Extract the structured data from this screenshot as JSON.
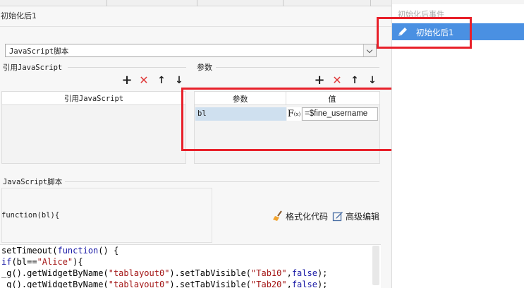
{
  "panel": {
    "title": "初始化后1"
  },
  "script_type": {
    "value": "JavaScript脚本"
  },
  "references": {
    "label": "引用JavaScript",
    "column_header": "引用JavaScript"
  },
  "params": {
    "label": "参数",
    "columns": [
      "参数",
      "值"
    ],
    "rows": [
      {
        "name": "bl",
        "formula_icon": "F",
        "formula_sub": "(x)",
        "value": "=$fine_username"
      }
    ]
  },
  "script": {
    "label": "JavaScript脚本",
    "signature": "function(bl){",
    "format_label": "格式化代码",
    "advanced_label": "高级编辑",
    "code_lines": [
      "setTimeout(function() {",
      "if(bl==\"Alice\"){",
      "_g().getWidgetByName(\"tablayout0\").setTabVisible(\"Tab10\",false);",
      "_g().getWidgetByName(\"tablayout0\").setTabVisible(\"Tab20\",false);"
    ]
  },
  "events": {
    "group_label": "初始化后事件",
    "items": [
      {
        "label": "初始化后1",
        "icon": "pencil-icon"
      }
    ]
  },
  "toolbar_icons": {
    "add": "+",
    "delete": "✕",
    "up": "↑",
    "down": "↓"
  },
  "colors": {
    "highlight": "#e8202a",
    "selection": "#4a90e2",
    "param_cell": "#cfe0ef"
  }
}
